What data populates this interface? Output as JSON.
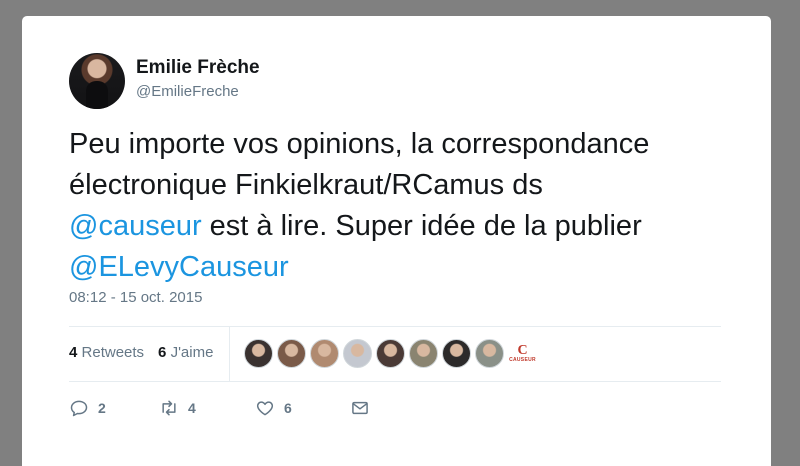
{
  "author": {
    "display_name": "Emilie Frèche",
    "screen_name": "@EmilieFreche"
  },
  "tweet": {
    "line1": "Peu importe vos opinions, la correspondance",
    "line2": "électronique Finkielkraut/RCamus ds",
    "mention1": "@causeur",
    "line3_rest": " est à lire. Super idée de la publier",
    "mention2": "@ELevyCauseur"
  },
  "timestamp": "08:12 - 15 oct. 2015",
  "stats": {
    "retweets_count": "4",
    "retweets_label": "Retweets",
    "likes_count": "6",
    "likes_label": "J'aime"
  },
  "likers": [
    {
      "name": "liker-1",
      "color": "#3a3230"
    },
    {
      "name": "liker-2",
      "color": "#7a5a48"
    },
    {
      "name": "liker-3",
      "color": "#b08a70"
    },
    {
      "name": "liker-4",
      "color": "#c4c8d0"
    },
    {
      "name": "liker-5",
      "color": "#4a3a36"
    },
    {
      "name": "liker-6",
      "color": "#8a8470"
    },
    {
      "name": "liker-7",
      "color": "#2c2a2a"
    },
    {
      "name": "liker-8",
      "color": "#8a9088"
    }
  ],
  "causeur_logo": {
    "letter": "C",
    "text": "CAUSEUR"
  },
  "actions": {
    "reply_count": "2",
    "retweet_count": "4",
    "like_count": "6"
  },
  "colors": {
    "link": "#1b95e0",
    "secondary": "#657786",
    "text": "#14171a",
    "backdrop": "#808080"
  }
}
